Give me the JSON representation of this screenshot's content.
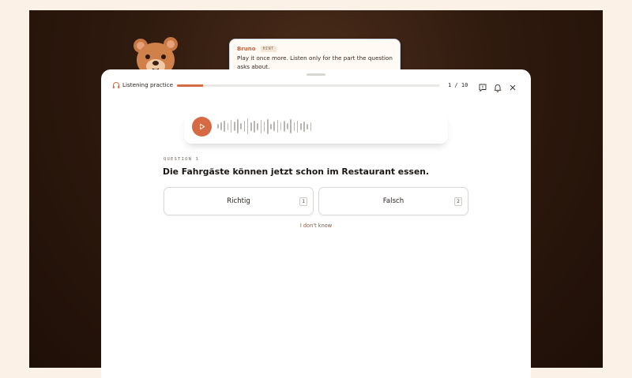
{
  "hint": {
    "name": "Bruno",
    "tag": "HINT",
    "text": "Play it once more. Listen only for the part the question asks about."
  },
  "header": {
    "title": "Listening practice",
    "counter": "1 / 10",
    "progress": 0.1,
    "icons": [
      "headphones-icon",
      "report-icon",
      "bell-icon",
      "close-icon"
    ]
  },
  "player": {
    "icon": "play-icon"
  },
  "question": {
    "label": "QUESTION 1",
    "text": "Die Fahrgäste können jetzt schon im Restaurant essen."
  },
  "options": [
    {
      "label": "Richtig",
      "key": "1"
    },
    {
      "label": "Falsch",
      "key": "2"
    }
  ],
  "skip_label": "I don't know",
  "colors": {
    "accent": "#d66a44",
    "background": "#fbf1e6",
    "stage": "#2f1a0e"
  }
}
